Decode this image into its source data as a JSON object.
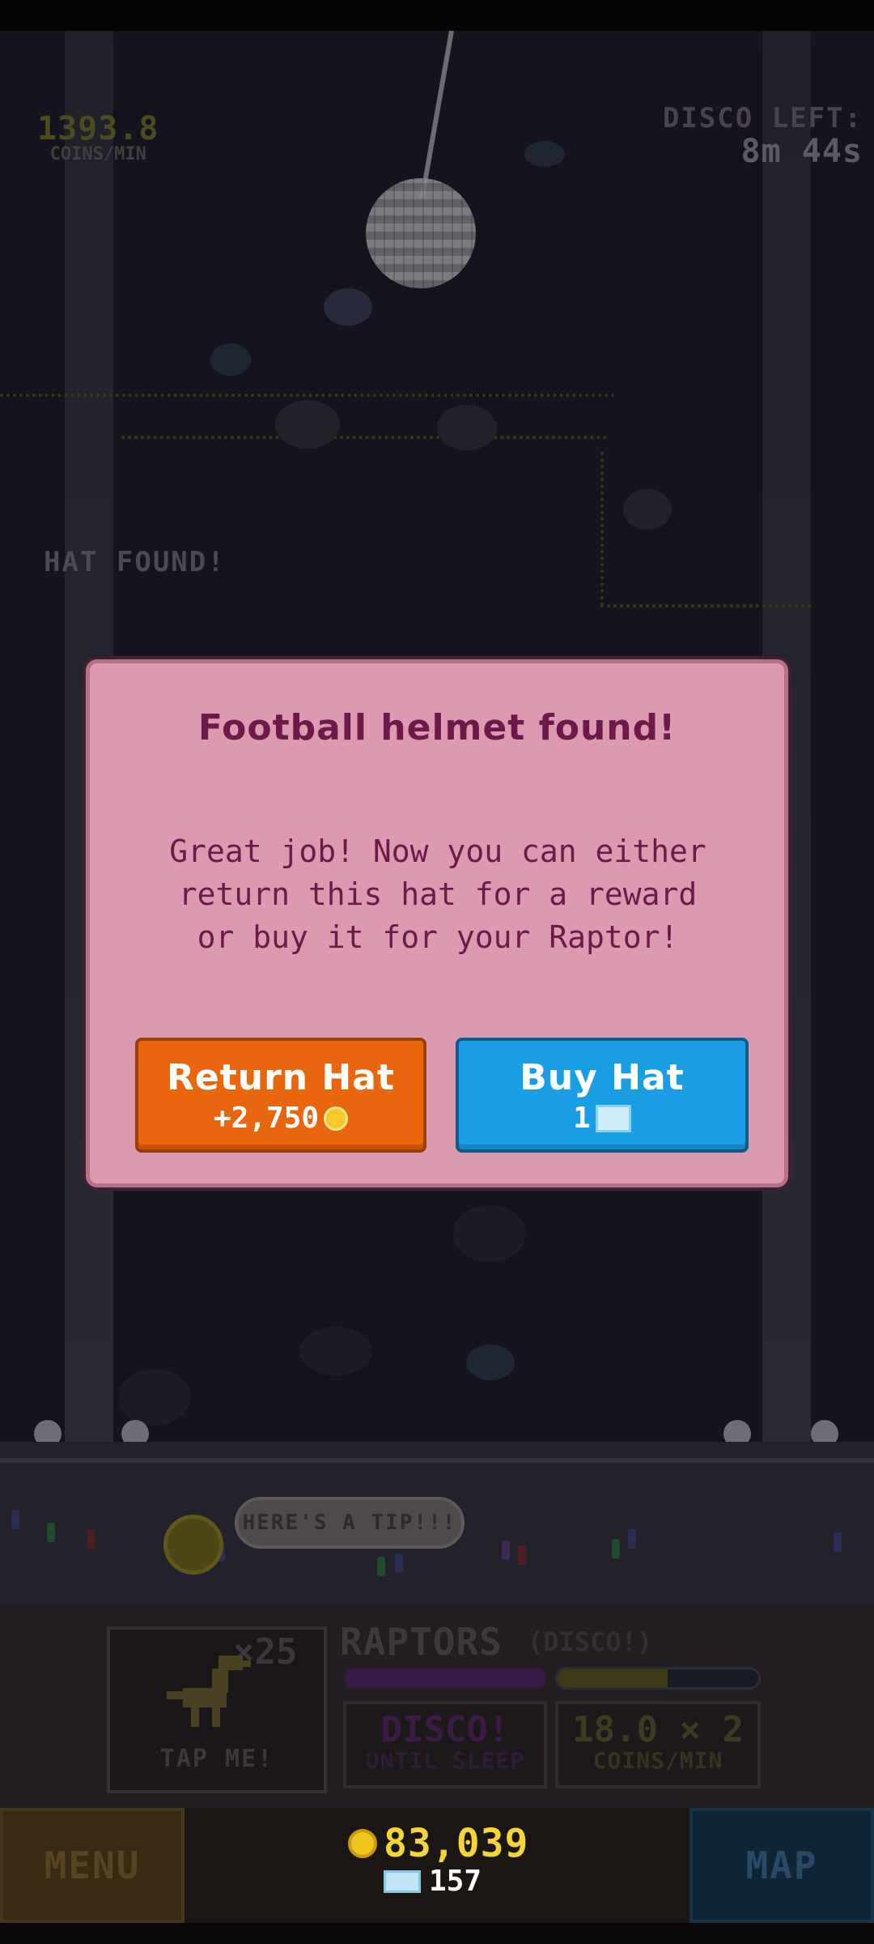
{
  "hud": {
    "coins_rate_value": "1393.8",
    "coins_rate_label": "COINS/MIN",
    "disco_left_label": "DISCO LEFT:",
    "disco_left_value": "8m 44s",
    "hat_found_banner": "HAT FOUND!"
  },
  "dialog": {
    "title": "Football helmet found!",
    "body_line1": "Great job! Now you can either",
    "body_line2": "return this hat for a reward",
    "body_line3": "or buy it for your Raptor!",
    "return_button": {
      "label": "Return Hat",
      "price": "+2,750",
      "icon": "coin-icon"
    },
    "buy_button": {
      "label": "Buy Hat",
      "price": "1",
      "icon": "gem-icon"
    }
  },
  "tip": {
    "label": "HERE'S A TIP!!!"
  },
  "panel": {
    "tap_multiplier": "×25",
    "tap_label": "TAP ME!",
    "species_title": "RAPTORS",
    "species_status": "(DISCO!)",
    "bar1_fill": 1.0,
    "bar2_fill": 0.55,
    "stat1_value": "DISCO!",
    "stat1_label": "UNTIL SLEEP",
    "stat2_value": "18.0 × 2",
    "stat2_label": "COINS/MIN"
  },
  "bottom": {
    "menu_label": "MENU",
    "map_label": "MAP",
    "coins": "83,039",
    "gems": "157"
  },
  "colors": {
    "dialog_bg": "#db9aaf",
    "dialog_text": "#6b1a4b",
    "return_button": "#e8660e",
    "buy_button": "#1a9ee3",
    "coin_text": "#f3d53a"
  }
}
